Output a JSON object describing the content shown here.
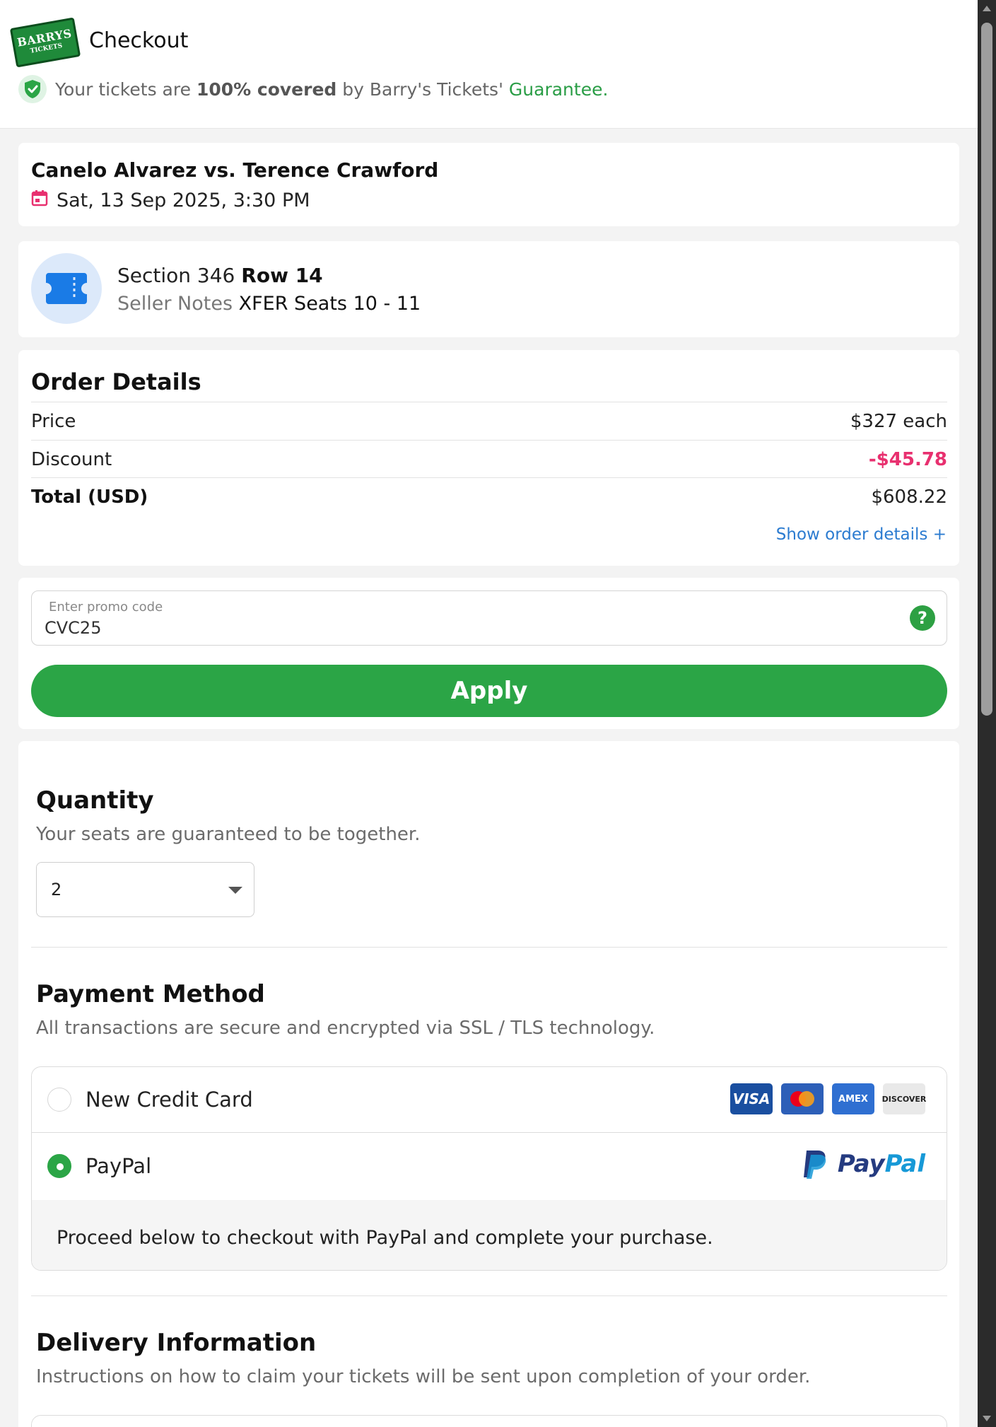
{
  "header": {
    "logo_text_line1": "BARRYS",
    "logo_text_line2": "TICKETS",
    "title": "Checkout",
    "guarantee_prefix": "Your tickets are ",
    "guarantee_bold": "100% covered",
    "guarantee_mid": " by Barry's Tickets' ",
    "guarantee_link": "Guarantee."
  },
  "event": {
    "title": "Canelo Alvarez vs. Terence Crawford",
    "date": "Sat, 13 Sep 2025, 3:30 PM"
  },
  "seat": {
    "section_label": "Section 346 ",
    "row_label": "Row 14",
    "notes_label": "Seller Notes ",
    "notes_value": "XFER Seats 10 - 11"
  },
  "order": {
    "title": "Order Details",
    "rows": [
      {
        "label": "Price",
        "value": "$327 each"
      },
      {
        "label": "Discount",
        "value": "-$45.78"
      },
      {
        "label": "Total (USD)",
        "value": "$608.22"
      }
    ],
    "show_details": "Show order details +"
  },
  "promo": {
    "label": "Enter promo code",
    "value": "CVC25",
    "help": "?",
    "apply_label": "Apply"
  },
  "quantity": {
    "title": "Quantity",
    "subtitle": "Your seats are guaranteed to be together.",
    "selected": "2"
  },
  "payment": {
    "title": "Payment Method",
    "subtitle": "All transactions are secure and encrypted via SSL / TLS technology.",
    "options": [
      {
        "label": "New Credit Card",
        "selected": false
      },
      {
        "label": "PayPal",
        "selected": true
      }
    ],
    "card_brands": [
      "VISA",
      "mastercard",
      "AMEX",
      "DISCOVER"
    ],
    "paypal_brand_pay": "Pay",
    "paypal_brand_pal": "Pal",
    "paypal_note": "Proceed below to checkout with PayPal and complete your purchase."
  },
  "delivery": {
    "title": "Delivery Information",
    "subtitle": "Instructions on how to claim your tickets will be sent upon completion of your order."
  },
  "colors": {
    "brand_green": "#2ba546",
    "discount_pink": "#e8306f",
    "link_blue": "#2b7bd0",
    "paypal_navy": "#253b80",
    "paypal_light": "#1799d7"
  }
}
